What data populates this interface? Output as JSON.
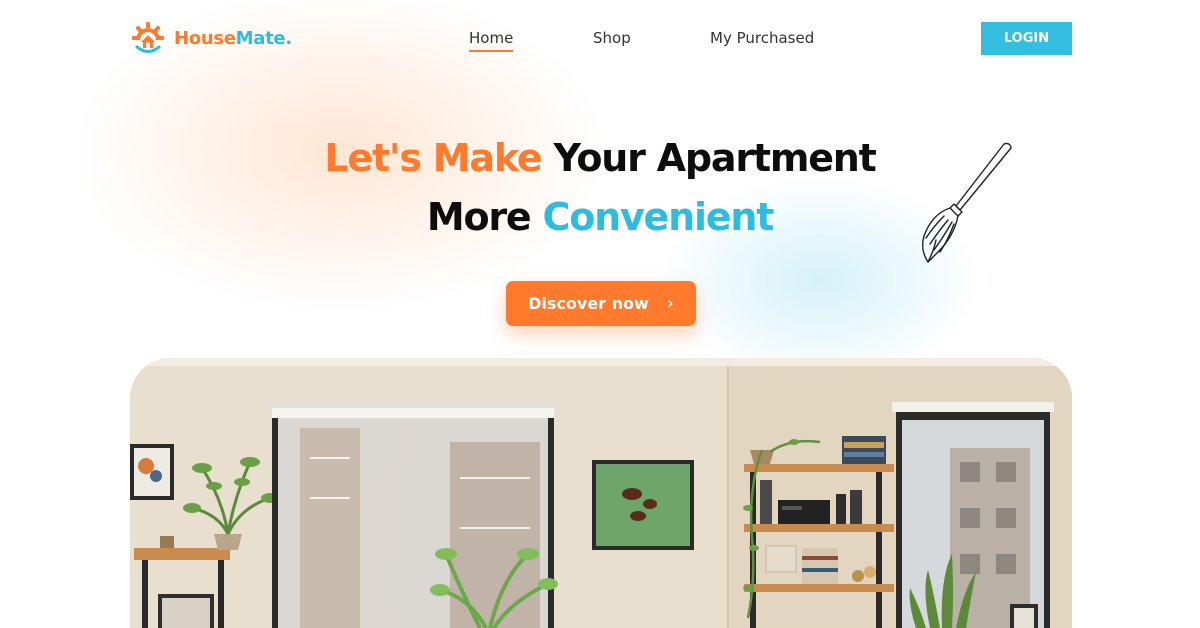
{
  "brand": {
    "name_part1": "House",
    "name_part2": "Mate.",
    "logo_icon": "gear-house-logo-icon",
    "orange": "#ff7a2d",
    "blue": "#2cbce0"
  },
  "nav": {
    "items": [
      {
        "label": "Home",
        "active": true
      },
      {
        "label": "Shop",
        "active": false
      },
      {
        "label": "My Purchased",
        "active": false
      }
    ],
    "login_label": "LOGIN"
  },
  "hero": {
    "line1_orange": "Let's Make",
    "line1_dark": " Your Apartment",
    "line2_dark": "More ",
    "line2_blue": "Convenient",
    "cta_label": "Discover now",
    "cta_icon": "chevron-right-icon",
    "decoration_icon": "broom-icon"
  },
  "image": {
    "subject": "apartment-living-room-photo"
  }
}
